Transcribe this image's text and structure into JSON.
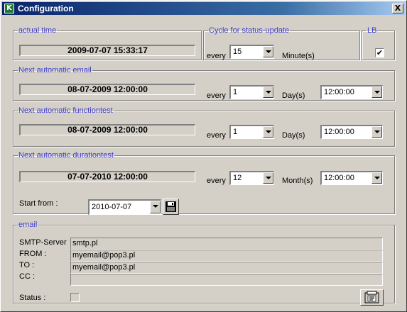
{
  "window": {
    "title": "Configuration",
    "app_icon_glyph": "K",
    "close_glyph": "X"
  },
  "actual_time": {
    "legend": "actual time",
    "value": "2009-07-07 15:33:17"
  },
  "cycle": {
    "legend": "Cycle for status-update",
    "every_label": "every",
    "value": "15",
    "unit": "Minute(s)"
  },
  "lb": {
    "legend": "LB",
    "checked": true,
    "check_glyph": "✔"
  },
  "email_schedule": {
    "legend": "Next automatic email",
    "datetime": "08-07-2009 12:00:00",
    "every_label": "every",
    "interval": "1",
    "unit": "Day(s)",
    "time": "12:00:00"
  },
  "functiontest": {
    "legend": "Next automatic functiontest",
    "datetime": "08-07-2009 12:00:00",
    "every_label": "every",
    "interval": "1",
    "unit": "Day(s)",
    "time": "12:00:00"
  },
  "durationtest": {
    "legend": "Next automatic durationtest",
    "datetime": "07-07-2010 12:00:00",
    "every_label": "every",
    "interval": "12",
    "unit": "Month(s)",
    "time": "12:00:00",
    "start_from_label": "Start from :",
    "start_from_value": "2010-07-07"
  },
  "email": {
    "legend": "email",
    "smtp_label": "SMTP-Server",
    "smtp_value": "smtp.pl",
    "from_label": "FROM :",
    "from_value": "myemail@pop3.pl",
    "to_label": "TO :",
    "to_value": "myemail@pop3.pl",
    "cc_label": "CC :",
    "cc_value": "",
    "status_label": "Status :",
    "status_checked": false
  },
  "colors": {
    "legend_text": "#3a3ad0",
    "titlebar_start": "#0a246a",
    "titlebar_end": "#a6caf0",
    "dialog_bg": "#d4d0c8"
  }
}
